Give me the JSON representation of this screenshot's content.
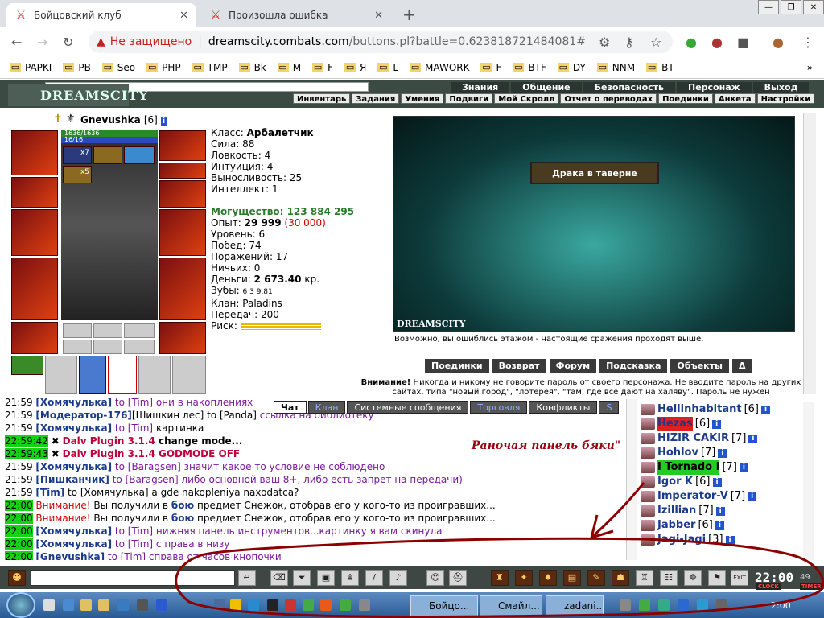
{
  "browser": {
    "tabs": [
      {
        "title": "Бойцовский клуб",
        "active": true
      },
      {
        "title": "Произошла ошибка",
        "active": false
      }
    ],
    "new_tab": "+",
    "address": {
      "security": "Не защищено",
      "host": "dreamscity.combats.com",
      "path": "/buttons.pl?battle=0.623818721484081#"
    },
    "bookmarks": [
      "PAPKI",
      "PB",
      "Seo",
      "PHP",
      "TMP",
      "Bk",
      "M",
      "F",
      "Я",
      "L",
      "MAWORK",
      "F",
      "BTF",
      "DY",
      "NNM",
      "BT"
    ],
    "more": "»"
  },
  "game": {
    "logo": "DREAMSCITY",
    "top_menu": [
      "Знания",
      "Общение",
      "Безопасность",
      "Персонаж",
      "Выход"
    ],
    "sub_menu": [
      "Инвентарь",
      "Задания",
      "Умения",
      "Подвиги",
      "Мой Скролл",
      "Отчет о переводах",
      "Поединки",
      "Анкета",
      "Настройки"
    ]
  },
  "character": {
    "name": "Gnevushka",
    "level": "[6]",
    "hp": "1636/1636",
    "mp": "16/16",
    "potion_counts": [
      "x7",
      "x5"
    ],
    "stats": [
      {
        "label": "Класс:",
        "value": "Арбалетчик",
        "bold": true
      },
      {
        "label": "Сила:",
        "value": "88"
      },
      {
        "label": "Ловкость:",
        "value": "4"
      },
      {
        "label": "Интуиция:",
        "value": "4"
      },
      {
        "label": "Выносливость:",
        "value": "25"
      },
      {
        "label": "Интеллект:",
        "value": "1"
      }
    ],
    "might_label": "Могущество:",
    "might_value": "123 884 295",
    "exp_label": "Опыт:",
    "exp_value": "29 999",
    "exp_next": "(30 000)",
    "level_label": "Уровень:",
    "level_value": "6",
    "wins_label": "Побед:",
    "wins_value": "74",
    "losses_label": "Поражений:",
    "losses_value": "17",
    "draws_label": "Ничьих:",
    "draws_value": "0",
    "money_label": "Деньги:",
    "money_value": "2 673.40",
    "money_unit": "кр.",
    "teeth_label": "Зубы:",
    "teeth_value": "6 3 9.81",
    "clan_label": "Клан:",
    "clan_value": "Paladins",
    "transfers_label": "Передач:",
    "transfers_value": "200",
    "risk_label": "Риск:"
  },
  "scene": {
    "banner": "Драка в таверне",
    "logo": "DREAMSCITY",
    "message": "Возможно, вы ошиблись этажом - настоящие сражения проходят выше."
  },
  "actions": [
    "Поединки",
    "Возврат",
    "Форум",
    "Подсказка",
    "Объекты",
    "Δ"
  ],
  "warning": {
    "bold": "Внимание!",
    "text": "Никогда и никому не говорите пароль от своего персонажа. Не вводите пароль на других сайтах, типа \"новый город\", \"лотерея\", \"там, где все дают на халяву\". Пароль не нужен"
  },
  "chat_tabs": [
    "Чат",
    "Клан",
    "Системные сообщения",
    "Торговля",
    "Конфликты",
    "S"
  ],
  "chat_note": "Раночая панель бяки\"",
  "chat": [
    {
      "time": "21:59",
      "green": false,
      "parts": [
        {
          "c": "nm",
          "t": "[Хомячулька]"
        },
        {
          "c": "ml",
          "t": " to [Tim] они в накоплениях"
        }
      ]
    },
    {
      "time": "21:59",
      "green": false,
      "parts": [
        {
          "c": "nm",
          "t": "[Модератор-176]"
        },
        {
          "c": "t",
          "t": "[Шишкин лес]"
        },
        {
          "c": "t",
          "t": " to [Panda] "
        },
        {
          "c": "ml",
          "t": "ссылка на библиотеку"
        }
      ]
    },
    {
      "time": "21:59",
      "green": false,
      "parts": [
        {
          "c": "nm",
          "t": "[Хомячулька]"
        },
        {
          "c": "ml",
          "t": " to [Tim] "
        },
        {
          "c": "t",
          "t": "картинка"
        }
      ]
    },
    {
      "time": "22:59:42",
      "green": true,
      "parts": [
        {
          "c": "t",
          "t": "✖ "
        },
        {
          "c": "dp",
          "t": "Dalv Plugin 3.1.4"
        },
        {
          "c": "plain",
          "t": "   change mode..."
        }
      ]
    },
    {
      "time": "22:59:43",
      "green": true,
      "parts": [
        {
          "c": "t",
          "t": "✖ "
        },
        {
          "c": "dp",
          "t": "Dalv Plugin 3.1.4"
        },
        {
          "c": "dp",
          "t": "   GODMODE OFF"
        }
      ]
    },
    {
      "time": "21:59",
      "green": false,
      "parts": [
        {
          "c": "nm",
          "t": "[Хомячулька]"
        },
        {
          "c": "ml",
          "t": " to [Baragsen] значит какое то условие не соблюдено"
        }
      ]
    },
    {
      "time": "21:59",
      "green": false,
      "parts": [
        {
          "c": "nm",
          "t": "[Пишканчик]"
        },
        {
          "c": "ml",
          "t": " to [Baragsen] либо основной ваш 8+, либо есть запрет на передачи)"
        }
      ]
    },
    {
      "time": "21:59",
      "green": false,
      "parts": [
        {
          "c": "nm",
          "t": "[Tim]"
        },
        {
          "c": "t",
          "t": " to [Хомячулька] a gde nakopleniya naxodatca?"
        }
      ]
    },
    {
      "time": "22:00",
      "green": true,
      "parts": [
        {
          "c": "red",
          "t": "Внимание!"
        },
        {
          "c": "t",
          "t": " Вы получили в "
        },
        {
          "c": "nm",
          "t": "бою"
        },
        {
          "c": "t",
          "t": " предмет Снежок, отобрав его у кого-то из проигравших..."
        }
      ]
    },
    {
      "time": "22:00",
      "green": true,
      "parts": [
        {
          "c": "red",
          "t": "Внимание!"
        },
        {
          "c": "t",
          "t": " Вы получили в "
        },
        {
          "c": "nm",
          "t": "бою"
        },
        {
          "c": "t",
          "t": " предмет Снежок, отобрав его у кого-то из проигравших..."
        }
      ]
    },
    {
      "time": "22:00",
      "green": true,
      "parts": [
        {
          "c": "nm",
          "t": "[Хомячулька]"
        },
        {
          "c": "ml",
          "t": " to [Tim] нижняя панель инструментов...картинку я вам скинула"
        }
      ]
    },
    {
      "time": "22:00",
      "green": true,
      "parts": [
        {
          "c": "nm",
          "t": "[Хомячулька]"
        },
        {
          "c": "ml",
          "t": " to [Tim] с права в низу"
        }
      ]
    },
    {
      "time": "22:00",
      "green": true,
      "parts": [
        {
          "c": "nm",
          "t": "[Gnevushka]"
        },
        {
          "c": "ml",
          "t": " to [Tim] справа от часов кнопочки"
        }
      ]
    }
  ],
  "players": [
    {
      "name": "Hellinhabitant",
      "level": "[6]",
      "hl": ""
    },
    {
      "name": "Hezas",
      "level": "[6]",
      "hl": "red"
    },
    {
      "name": "HIZIR CAKIR",
      "level": "[7]",
      "hl": ""
    },
    {
      "name": "Hohlov",
      "level": "[7]",
      "hl": ""
    },
    {
      "name": "I Tornado I",
      "level": "[7]",
      "hl": "green"
    },
    {
      "name": "Igor K",
      "level": "[6]",
      "hl": ""
    },
    {
      "name": "Imperator-V",
      "level": "[7]",
      "hl": ""
    },
    {
      "name": "Izillian",
      "level": "[7]",
      "hl": ""
    },
    {
      "name": "Jabber",
      "level": "[6]",
      "hl": ""
    },
    {
      "name": "Jagi-Jagi",
      "level": "[3]",
      "hl": ""
    }
  ],
  "toolbar": {
    "clock": "22:00",
    "clock_sec": "49",
    "clock_label": "CLOCK",
    "timer_label": "TIMER"
  },
  "taskbar": {
    "tasks": [
      "Бойцо...",
      "Смайл...",
      "zadani..."
    ],
    "time": "2:00"
  },
  "colors": {
    "annotation": "#8b0000",
    "accent_green": "#13d313"
  }
}
